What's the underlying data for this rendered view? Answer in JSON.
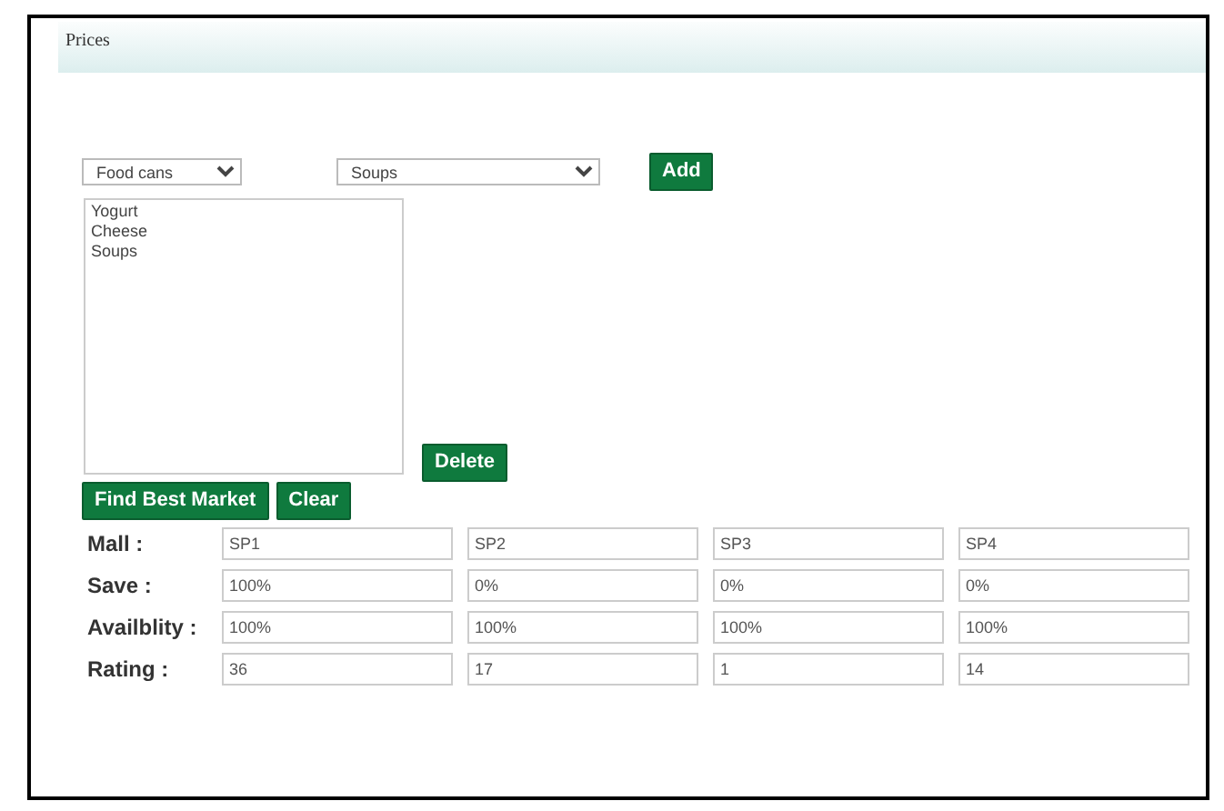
{
  "header": {
    "title": "Prices"
  },
  "category_select": {
    "value": "Food cans"
  },
  "item_select": {
    "value": "Soups"
  },
  "add_button": "Add",
  "selected_items": [
    {
      "label": "Yogurt",
      "selected": false
    },
    {
      "label": "Cheese",
      "selected": false
    },
    {
      "label": "Soups",
      "selected": false
    }
  ],
  "delete_button": "Delete",
  "buttons": [
    "Find Best Market",
    "Clear"
  ],
  "results": [
    {
      "label": "Mall :",
      "values": [
        "SP1",
        "SP2",
        "SP3",
        "SP4"
      ]
    },
    {
      "label": "Save :",
      "values": [
        "100%",
        "0%",
        "0%",
        "0%"
      ]
    },
    {
      "label": "Availblity :",
      "values": [
        "100%",
        "100%",
        "100%",
        "100%"
      ]
    },
    {
      "label": "Rating :",
      "values": [
        "36",
        "17",
        "1",
        "14"
      ]
    }
  ]
}
